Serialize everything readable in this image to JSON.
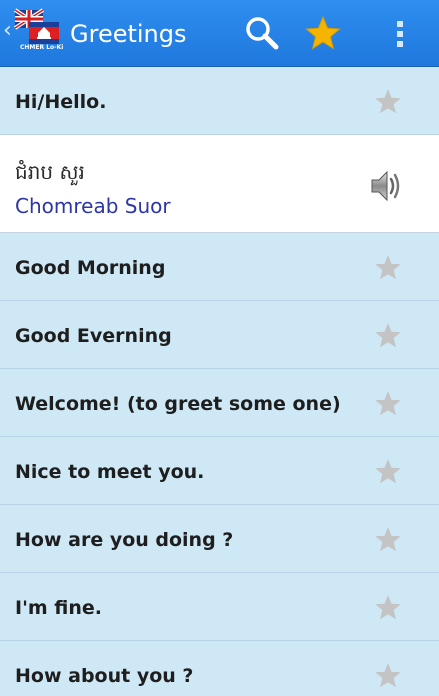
{
  "appbar": {
    "title": "Greetings",
    "logo_caption": "CHMER Lo-Ki",
    "actions": [
      {
        "name": "search",
        "icon": "search-icon"
      },
      {
        "name": "favorites",
        "icon": "star-icon",
        "color": "#f5b400"
      },
      {
        "name": "overflow",
        "icon": "overflow-menu-icon"
      }
    ],
    "color": "#2584e6"
  },
  "phrases": [
    {
      "label": "Hi/Hello.",
      "favorite": false
    },
    {
      "khmer": "ជំរាប សួរ",
      "romanized": "Chomreab Suor",
      "selected": true,
      "icon": "speaker-icon"
    },
    {
      "label": "Good Morning",
      "favorite": false
    },
    {
      "label": "Good Everning",
      "favorite": false
    },
    {
      "label": "Welcome! (to greet some one)",
      "favorite": false
    },
    {
      "label": "Nice to meet you.",
      "favorite": false
    },
    {
      "label": "How are you doing ?",
      "favorite": false
    },
    {
      "label": "I'm fine.",
      "favorite": false
    },
    {
      "label": "How about you ?",
      "favorite": false
    }
  ],
  "colors": {
    "row_bg": "#cfe8f5",
    "selected_bg": "#ffffff",
    "romanized_text": "#2d36a6",
    "star_inactive": "#c4c4c4"
  }
}
